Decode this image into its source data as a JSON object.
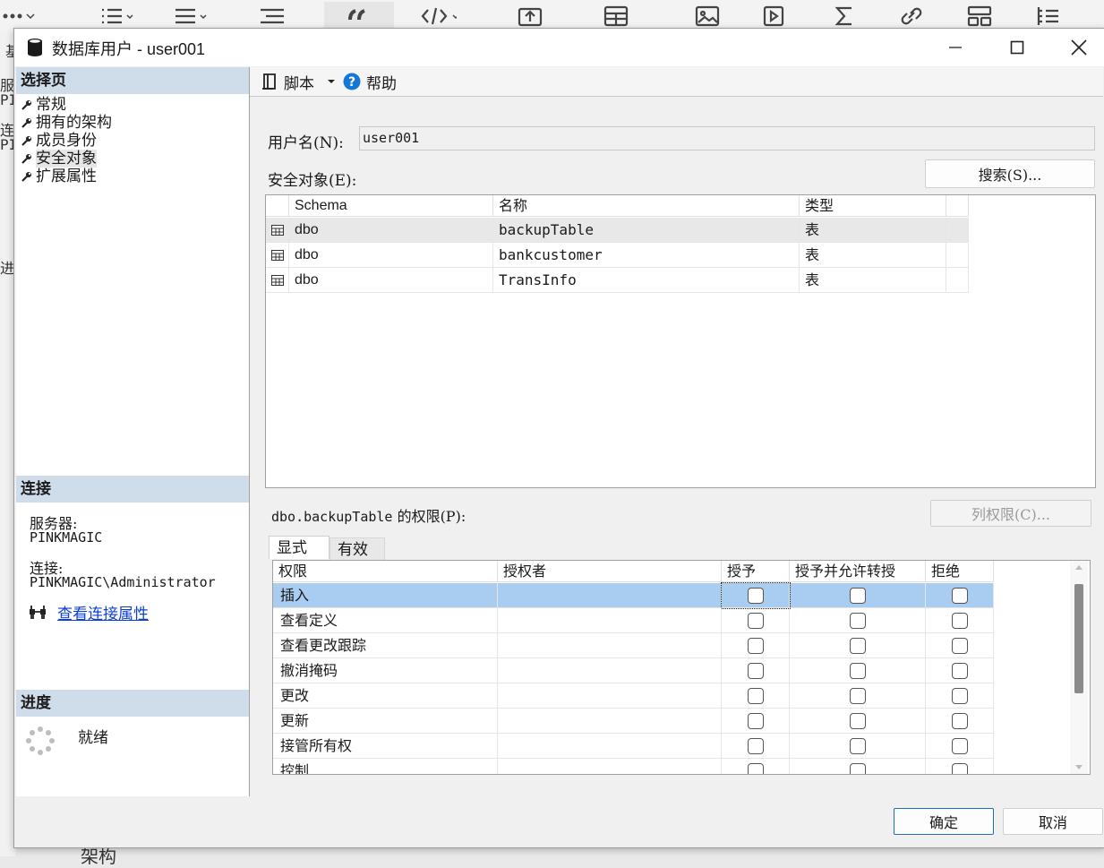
{
  "background": {
    "frag_1": "基",
    "frag_2": "服",
    "frag_3": "PI",
    "frag_4": "连",
    "frag_5": "PI",
    "frag_6": "进",
    "frag_7": "架构"
  },
  "dialog": {
    "title": "数据库用户 - user001",
    "controls": {
      "minimize": "minimize-icon",
      "maximize": "maximize-icon",
      "close": "close-icon"
    }
  },
  "left": {
    "select_page_header": "选择页",
    "nav_items": [
      "常规",
      "拥有的架构",
      "成员身份",
      "安全对象",
      "扩展属性"
    ],
    "selected_index": 3,
    "connection_header": "连接",
    "server_label": "服务器:",
    "server_value": "PINKMAGIC",
    "connection_label": "连接:",
    "connection_value": "PINKMAGIC\\Administrator",
    "view_link": "查看连接属性",
    "progress_header": "进度",
    "progress_status": "就绪"
  },
  "toolbar": {
    "script_label": "脚本",
    "help_label": "帮助"
  },
  "form": {
    "username_label": "用户名(N):",
    "username_value": "user001",
    "securables_label": "安全对象(E):",
    "search_button": "搜索(S)..."
  },
  "objects": {
    "columns": [
      "Schema",
      "名称",
      "类型"
    ],
    "rows": [
      {
        "schema": "dbo",
        "name": "backupTable",
        "type": "表"
      },
      {
        "schema": "dbo",
        "name": "bankcustomer",
        "type": "表"
      },
      {
        "schema": "dbo",
        "name": "TransInfo",
        "type": "表"
      }
    ],
    "selected_row": 0
  },
  "permissions": {
    "label_object": "dbo.backupTable",
    "label_suffix": "的权限(P):",
    "column_perms_button": "列权限(C)...",
    "tabs": [
      "显式",
      "有效"
    ],
    "active_tab": 0,
    "columns": [
      "权限",
      "授权者",
      "授予",
      "授予并允许转授",
      "拒绝"
    ],
    "rows": [
      {
        "perm": "插入",
        "grantor": "",
        "grant": false,
        "with_grant": false,
        "deny": false
      },
      {
        "perm": "查看定义",
        "grantor": "",
        "grant": false,
        "with_grant": false,
        "deny": false
      },
      {
        "perm": "查看更改跟踪",
        "grantor": "",
        "grant": false,
        "with_grant": false,
        "deny": false
      },
      {
        "perm": "撤消掩码",
        "grantor": "",
        "grant": false,
        "with_grant": false,
        "deny": false
      },
      {
        "perm": "更改",
        "grantor": "",
        "grant": false,
        "with_grant": false,
        "deny": false
      },
      {
        "perm": "更新",
        "grantor": "",
        "grant": false,
        "with_grant": false,
        "deny": false
      },
      {
        "perm": "接管所有权",
        "grantor": "",
        "grant": false,
        "with_grant": false,
        "deny": false
      },
      {
        "perm": "控制",
        "grantor": "",
        "grant": false,
        "with_grant": false,
        "deny": false
      }
    ],
    "selected_row": 0
  },
  "footer": {
    "ok": "确定",
    "cancel": "取消"
  },
  "colors": {
    "section_header": "#cfdcea",
    "selection": "#a9cdf0",
    "link": "#0b3fd6"
  }
}
